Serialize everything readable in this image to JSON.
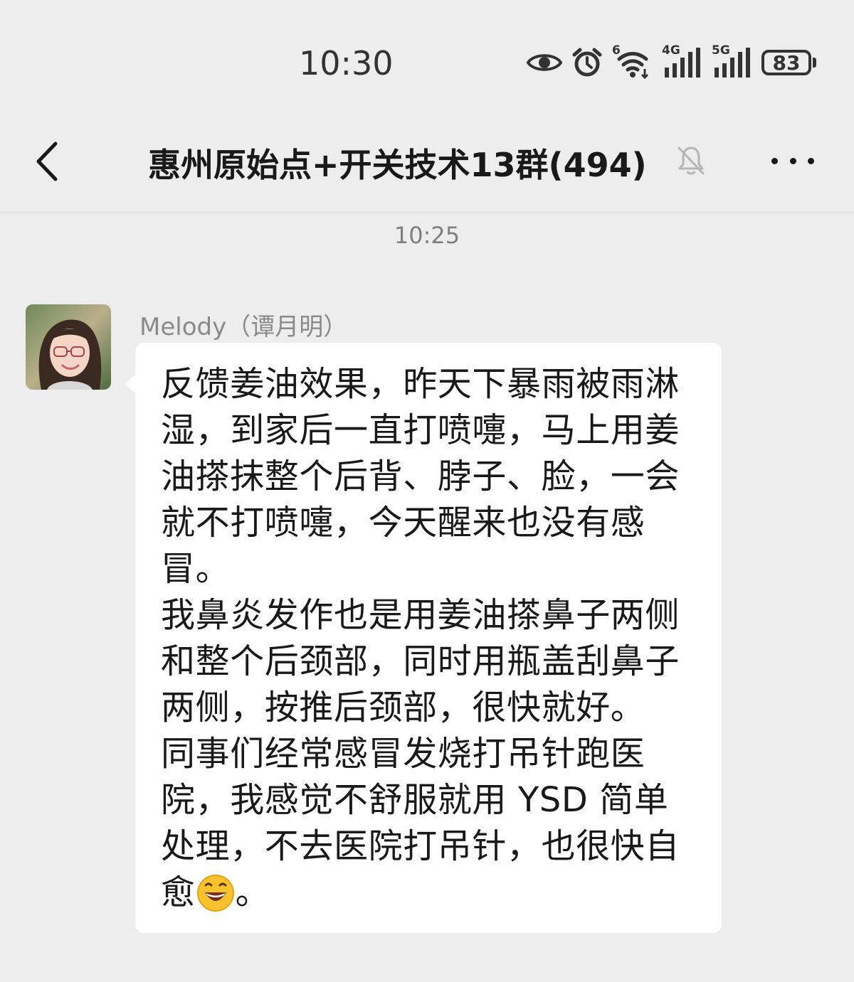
{
  "status_bar": {
    "time": "10:30",
    "icons": [
      "eye-icon",
      "alarm-icon",
      "wifi-6-icon",
      "signal-4g-icon",
      "signal-5g-icon"
    ],
    "wifi_label": "6",
    "net1_label": "4G",
    "net2_label": "5G",
    "battery": "83"
  },
  "nav": {
    "title": "惠州原始点+开关技术13群(494)",
    "muted": true
  },
  "chat": {
    "timestamp": "10:25",
    "messages": [
      {
        "sender": "Melody（谭月明）",
        "text": "反馈姜油效果，昨天下暴雨被雨淋湿，到家后一直打喷嚏，马上用姜油搽抹整个后背、脖子、脸，一会就不打喷嚏，今天醒来也没有感冒。\n我鼻炎发作也是用姜油搽鼻子两侧和整个后颈部，同时用瓶盖刮鼻子两侧，按推后颈部，很快就好。\n同事们经常感冒发烧打吊针跑医院，我感觉不舒服就用 YSD 简单处理，不去医院打吊针，也很快自愈",
        "tail": "。",
        "emoji": "grinning-face-emoji"
      }
    ]
  },
  "colors": {
    "background": "#ededed",
    "bubble": "#ffffff",
    "text": "#191919",
    "secondary_text": "#7f7f7f"
  }
}
